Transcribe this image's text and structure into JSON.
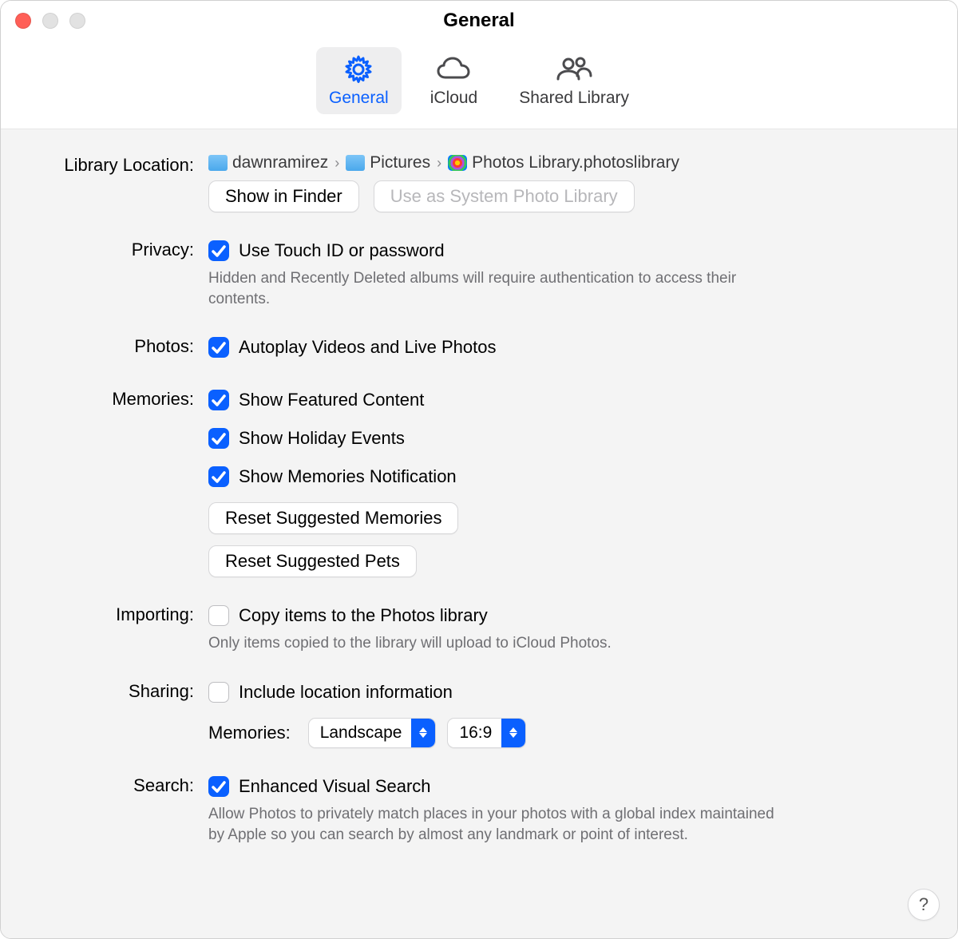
{
  "title": "General",
  "tabs": {
    "general": "General",
    "icloud": "iCloud",
    "shared": "Shared Library"
  },
  "library": {
    "label": "Library Location:",
    "crumb1": "dawnramirez",
    "crumb2": "Pictures",
    "crumb3": "Photos Library.photoslibrary",
    "show_in_finder": "Show in Finder",
    "use_system": "Use as System Photo Library"
  },
  "privacy": {
    "label": "Privacy:",
    "touchid": "Use Touch ID or password",
    "desc": "Hidden and Recently Deleted albums will require authentication to access their contents."
  },
  "photos": {
    "label": "Photos:",
    "autoplay": "Autoplay Videos and Live Photos"
  },
  "memories": {
    "label": "Memories:",
    "featured": "Show Featured Content",
    "holiday": "Show Holiday Events",
    "notif": "Show Memories Notification",
    "reset_mem": "Reset Suggested Memories",
    "reset_pets": "Reset Suggested Pets"
  },
  "importing": {
    "label": "Importing:",
    "copy": "Copy items to the Photos library",
    "desc": "Only items copied to the library will upload to iCloud Photos."
  },
  "sharing": {
    "label": "Sharing:",
    "location": "Include location information",
    "memories_label": "Memories:",
    "orientation": "Landscape",
    "ratio": "16:9"
  },
  "search": {
    "label": "Search:",
    "evs": "Enhanced Visual Search",
    "desc": "Allow Photos to privately match places in your photos with a global index maintained by Apple so you can search by almost any landmark or point of interest."
  },
  "help": "?"
}
